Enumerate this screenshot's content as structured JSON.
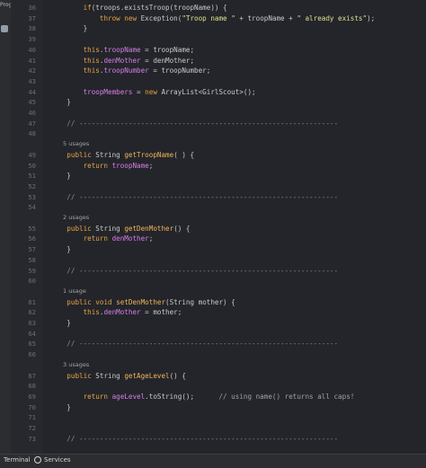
{
  "sidebar": {
    "label": "Progr"
  },
  "lines": [
    {
      "num": "36",
      "html": "        <span class=\"kw\">if</span>(troops.existsTroop(troopName)) {"
    },
    {
      "num": "37",
      "html": "            <span class=\"kw\">throw new</span> Exception(<span class=\"str\">\"Troop name \"</span> + troopName + <span class=\"str\">\" already exists\"</span>);"
    },
    {
      "num": "38",
      "html": "        }"
    },
    {
      "num": "39",
      "html": ""
    },
    {
      "num": "40",
      "html": "        <span class=\"kw\">this</span>.<span class=\"fld\">troopName</span> = troopName;"
    },
    {
      "num": "41",
      "html": "        <span class=\"kw\">this</span>.<span class=\"fld\">denMother</span> = denMother;"
    },
    {
      "num": "42",
      "html": "        <span class=\"kw\">this</span>.<span class=\"fld\">troopNumber</span> = troopNumber;"
    },
    {
      "num": "43",
      "html": ""
    },
    {
      "num": "44",
      "html": "        <span class=\"fld\">troopMembers</span> = <span class=\"kw\">new</span> ArrayList&lt;GirlScout&gt;();"
    },
    {
      "num": "45",
      "html": "    }"
    },
    {
      "num": "46",
      "html": ""
    },
    {
      "num": "47",
      "html": "    <span class=\"sep\">// ---------------------------------------------------------------</span>"
    },
    {
      "num": "48",
      "html": ""
    },
    {
      "num": "",
      "hint": "5 usages"
    },
    {
      "num": "49",
      "html": "    <span class=\"kw\">public</span> String <span class=\"fn\">getTroopName</span>( ) {"
    },
    {
      "num": "50",
      "html": "        <span class=\"kw\">return</span> <span class=\"fld\">troopName</span>;"
    },
    {
      "num": "51",
      "html": "    }"
    },
    {
      "num": "52",
      "html": ""
    },
    {
      "num": "53",
      "html": "    <span class=\"sep\">// ---------------------------------------------------------------</span>"
    },
    {
      "num": "54",
      "html": ""
    },
    {
      "num": "",
      "hint": "2 usages"
    },
    {
      "num": "55",
      "html": "    <span class=\"kw\">public</span> String <span class=\"fn\">getDenMother</span>() {"
    },
    {
      "num": "56",
      "html": "        <span class=\"kw\">return</span> <span class=\"fld\">denMother</span>;"
    },
    {
      "num": "57",
      "html": "    }"
    },
    {
      "num": "58",
      "html": ""
    },
    {
      "num": "59",
      "html": "    <span class=\"sep\">// ---------------------------------------------------------------</span>"
    },
    {
      "num": "60",
      "html": ""
    },
    {
      "num": "",
      "hint": "1 usage"
    },
    {
      "num": "61",
      "html": "    <span class=\"kw\">public void</span> <span class=\"fn\">setDenMother</span>(String mother) {"
    },
    {
      "num": "62",
      "html": "        <span class=\"kw\">this</span>.<span class=\"fld\">denMother</span> = mother;"
    },
    {
      "num": "63",
      "html": "    }"
    },
    {
      "num": "64",
      "html": ""
    },
    {
      "num": "65",
      "html": "    <span class=\"sep\">// ---------------------------------------------------------------</span>"
    },
    {
      "num": "66",
      "html": ""
    },
    {
      "num": "",
      "hint": "3 usages"
    },
    {
      "num": "67",
      "html": "    <span class=\"kw\">public</span> String <span class=\"fn\">getAgeLevel</span>() {"
    },
    {
      "num": "68",
      "html": ""
    },
    {
      "num": "69",
      "html": "        <span class=\"kw\">return</span> <span class=\"fld\">ageLevel</span>.toString();      <span class=\"cm\">// using name() returns all caps!</span>"
    },
    {
      "num": "70",
      "html": "    }"
    },
    {
      "num": "71",
      "html": ""
    },
    {
      "num": "72",
      "html": ""
    },
    {
      "num": "73",
      "html": "    <span class=\"sep\">// ---------------------------------------------------------------</span>"
    }
  ],
  "statusbar": {
    "terminal": "Terminal",
    "services": "Services"
  }
}
